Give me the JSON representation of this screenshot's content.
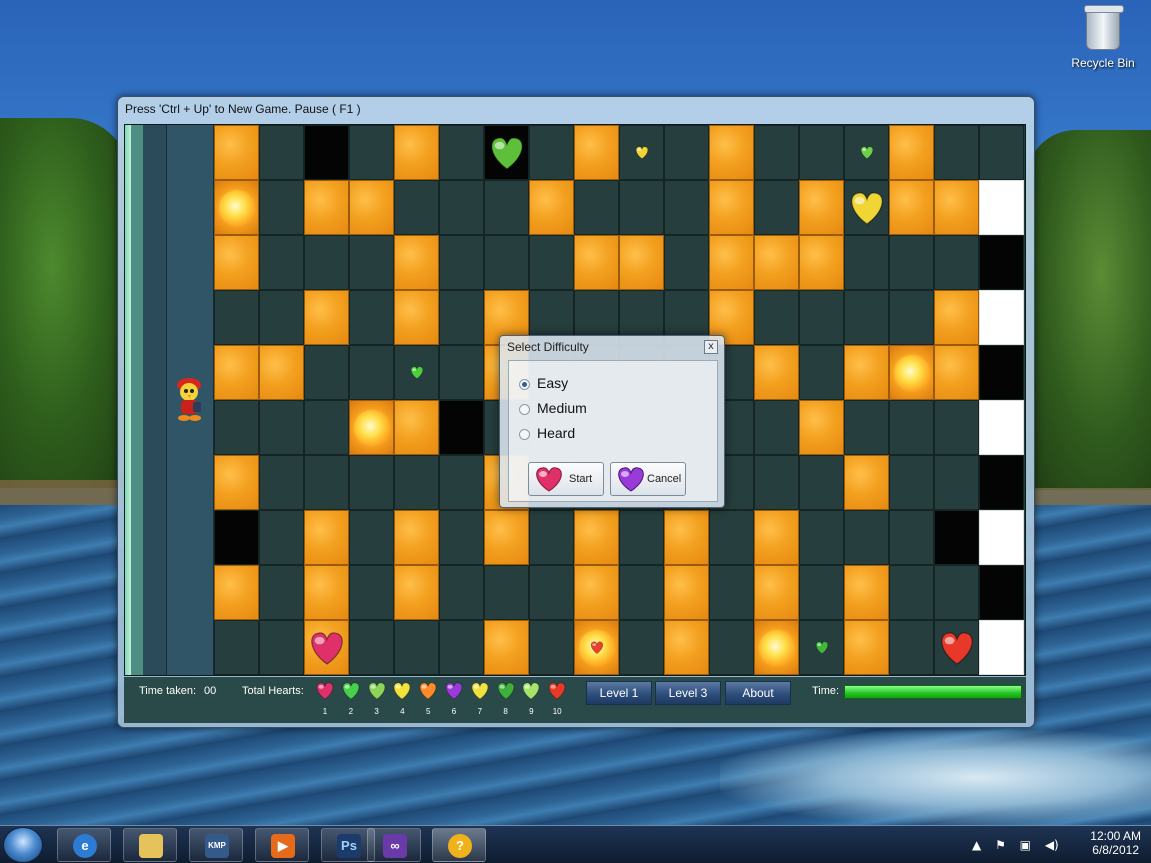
{
  "desktop": {
    "recycle_bin_label": "Recycle Bin"
  },
  "window": {
    "title": "Press 'Ctrl + Up' to New Game. Pause ( F1 )"
  },
  "status_bar": {
    "time_taken_label": "Time taken:",
    "time_taken_value": "00",
    "total_hearts_label": "Total Hearts:",
    "heart_numbers": [
      "1",
      "2",
      "3",
      "4",
      "5",
      "6",
      "7",
      "8",
      "9",
      "10"
    ],
    "heart_colors": [
      "#e0306a",
      "#48d04a",
      "#8ed35a",
      "#f3e23a",
      "#ff8a2a",
      "#9a3ad8",
      "#f0e040",
      "#3fae3a",
      "#a6e36a",
      "#e8382a"
    ],
    "buttons": [
      "Level 1",
      "Level 3",
      "About"
    ],
    "time_label": "Time:",
    "time_remaining_fraction": 1.0
  },
  "dialog": {
    "title": "Select Difficulty",
    "close_label": "x",
    "options": [
      "Easy",
      "Medium",
      "Heard"
    ],
    "selected": "Easy",
    "start_label": "Start",
    "cancel_label": "Cancel"
  },
  "taskbar": {
    "time": "12:00 AM",
    "date": "6/8/2012",
    "pinned_icons": [
      "internet-explorer-icon",
      "file-explorer-icon",
      "kmplayer-icon",
      "media-player-icon",
      "photoshop-icon",
      "visual-studio-icon",
      "help-icon"
    ],
    "ps_label": "Ps",
    "kmp_label": "KMP",
    "help_label": "?"
  },
  "board": {
    "rows": [
      "OJBJOJBJOJJOJJJOJJ",
      "FJOOJJJOJJJOJOJOOW",
      "OJJJOJJJOOJOOOJJJB",
      "JJOJOJOJJJJOJJJJOW",
      "OOJJJJOJJJJJOJOFOB",
      "JJJFOBJJJJJJJOJJJW",
      "OJJJJJOJJJJJJJOJJB",
      "BJOJOJOJOJOJOJJJBW",
      "OJOJOJJJOJOJOJOJJB",
      "JJOJJJOJFJOJFJOJJW"
    ],
    "hearts": [
      {
        "col": 6,
        "row": 0,
        "size": "big",
        "color": "#5dbf3a"
      },
      {
        "col": 9,
        "row": 0,
        "size": "small",
        "color": "#f0d535"
      },
      {
        "col": 14,
        "row": 0,
        "size": "small",
        "color": "#6dd04a"
      },
      {
        "col": 14,
        "row": 1,
        "size": "big",
        "color": "#f0d535"
      },
      {
        "col": 4,
        "row": 4,
        "size": "small",
        "color": "#4ccf3a"
      },
      {
        "col": 2,
        "row": 9,
        "size": "big",
        "color": "#e0306a"
      },
      {
        "col": 8,
        "row": 9,
        "size": "small",
        "color": "#e8402a"
      },
      {
        "col": 13,
        "row": 9,
        "size": "small",
        "color": "#3fb83a"
      },
      {
        "col": 16,
        "row": 9,
        "size": "big",
        "color": "#e8382a"
      }
    ]
  }
}
